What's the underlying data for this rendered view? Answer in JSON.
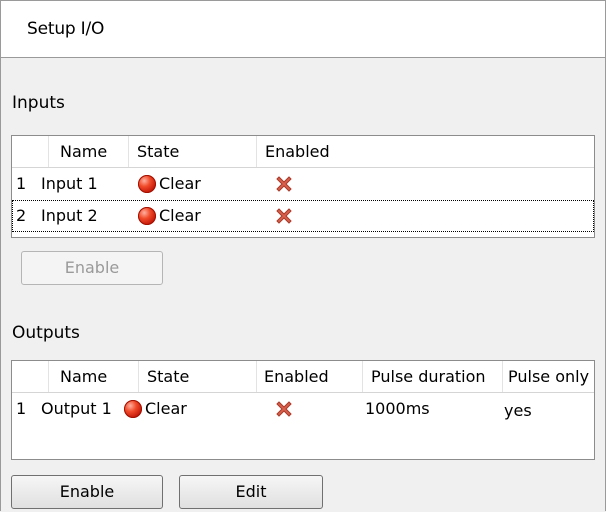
{
  "window": {
    "title": "Setup I/O"
  },
  "inputs": {
    "label": "Inputs",
    "columns": [
      "",
      "Name",
      "State",
      "Enabled"
    ],
    "rows": [
      {
        "index": "1",
        "name": "Input 1",
        "state": "Clear",
        "state_icon": "red-led-icon",
        "enabled_icon": "red-x-icon",
        "focused": false
      },
      {
        "index": "2",
        "name": "Input 2",
        "state": "Clear",
        "state_icon": "red-led-icon",
        "enabled_icon": "red-x-icon",
        "focused": true
      }
    ],
    "enable_button": {
      "label": "Enable",
      "disabled": true
    }
  },
  "outputs": {
    "label": "Outputs",
    "columns": [
      "",
      "Name",
      "State",
      "Enabled",
      "Pulse duration",
      "Pulse only"
    ],
    "rows": [
      {
        "index": "1",
        "name": "Output 1",
        "state": "Clear",
        "state_icon": "red-led-icon",
        "enabled_icon": "red-x-icon",
        "pulse_duration": "1000ms",
        "pulse_only": "yes"
      }
    ],
    "enable_button": {
      "label": "Enable",
      "disabled": false
    },
    "edit_button": {
      "label": "Edit",
      "disabled": false
    }
  },
  "colors": {
    "led_red": "#d8240f",
    "x_red": "#c84b3a",
    "disabled_text": "#9a9a9a"
  }
}
